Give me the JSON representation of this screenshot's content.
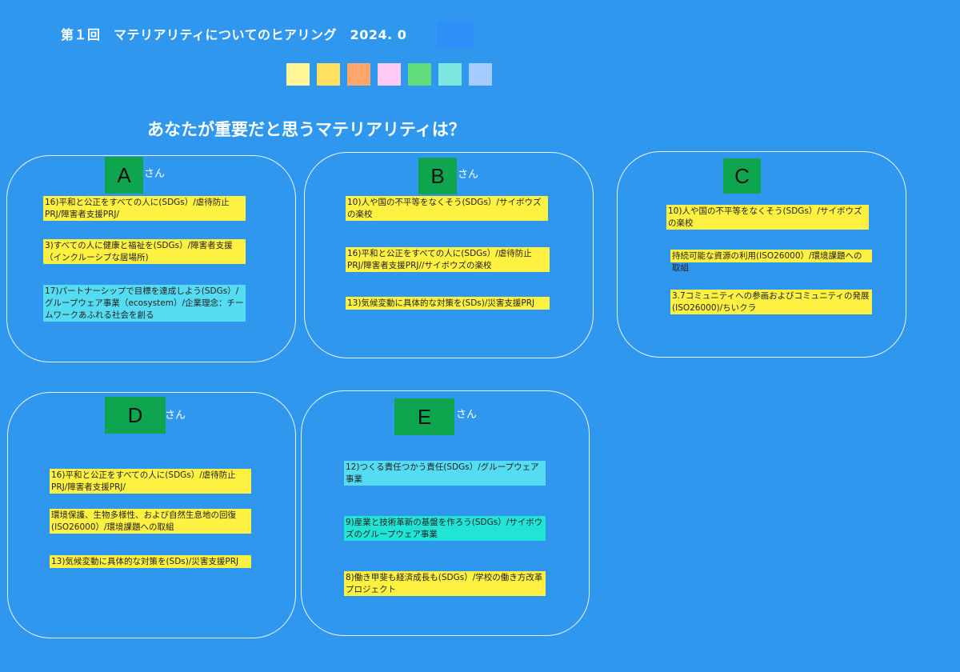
{
  "header": {
    "title": "第１回　マテリアリティについてのヒアリング　2024. 0"
  },
  "swatches": [
    {
      "name": "light-yellow",
      "color": "#fff597"
    },
    {
      "name": "yellow",
      "color": "#ffe061"
    },
    {
      "name": "orange",
      "color": "#ffa66c"
    },
    {
      "name": "pink",
      "color": "#ffcaf5"
    },
    {
      "name": "green",
      "color": "#60dc7b"
    },
    {
      "name": "mint",
      "color": "#7de6df"
    },
    {
      "name": "light-blue",
      "color": "#a6cbff"
    }
  ],
  "question": "あなたが重要だと思うマテリアリティは？",
  "suffix": "さん",
  "panels": [
    {
      "id": "A",
      "label": "A",
      "notes": [
        {
          "text": "16)平和と公正をすべての人に(SDGs）/虐待防止PRJ/障害者支援PRJ/",
          "color": "yellow"
        },
        {
          "text": "3)すべての人に健康と福祉を(SDGs）/障害者支援（インクルーシブな居場所)",
          "color": "yellow"
        },
        {
          "text": "17)パートナーシップで目標を達成しよう(SDGs）/グループウェア事業（ecosystem）/企業理念：チームワークあふれる社会を創る",
          "color": "cyan"
        }
      ]
    },
    {
      "id": "B",
      "label": "B",
      "notes": [
        {
          "text": "10)人や国の不平等をなくそう(SDGs）/サイボウズの楽校",
          "color": "yellow"
        },
        {
          "text": "16)平和と公正をすべての人に(SDGs）/虐待防止PRJ/障害者支援PRJ//サイボウズの楽校",
          "color": "yellow"
        },
        {
          "text": "13)気候変動に具体的な対策を(SDs)/災害支援PRJ",
          "color": "yellow"
        }
      ]
    },
    {
      "id": "C",
      "label": "C",
      "notes": [
        {
          "text": "10)人や国の不平等をなくそう(SDGs）/サイボウズの楽校",
          "color": "yellow"
        },
        {
          "text": "持続可能な資源の利用(ISO26000）/環境課題への取組",
          "color": "yellow"
        },
        {
          "text": "3.7コミュニティへの参画およびコミュニティの発展(ISO26000)/ちいクラ",
          "color": "yellow"
        }
      ]
    },
    {
      "id": "D",
      "label": "D",
      "notes": [
        {
          "text": "16)平和と公正をすべての人に(SDGs）/虐待防止PRJ/障害者支援PRJ/",
          "color": "yellow"
        },
        {
          "text": "環境保護、生物多様性、および自然生息地の回復(ISO26000）/環境課題への取組",
          "color": "yellow"
        },
        {
          "text": "13)気候変動に具体的な対策を(SDs)/災害支援PRJ",
          "color": "yellow"
        }
      ]
    },
    {
      "id": "E",
      "label": "E",
      "notes": [
        {
          "text": "12)つくる責任つかう責任(SDGs）/グループウェア事業",
          "color": "cyan"
        },
        {
          "text": "9)産業と技術革新の基盤を作ろう(SDGs）/サイボウズのグループウェア事業",
          "color": "teal"
        },
        {
          "text": "8)働き甲斐も経済成長も(SDGs）/学校の働き方改革プロジェクト",
          "color": "yellow"
        }
      ]
    }
  ]
}
